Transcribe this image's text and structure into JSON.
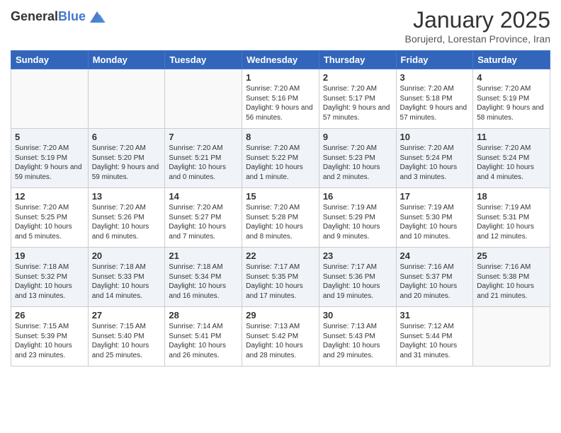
{
  "header": {
    "logo_general": "General",
    "logo_blue": "Blue",
    "month_title": "January 2025",
    "location": "Borujerd, Lorestan Province, Iran"
  },
  "days_of_week": [
    "Sunday",
    "Monday",
    "Tuesday",
    "Wednesday",
    "Thursday",
    "Friday",
    "Saturday"
  ],
  "weeks": [
    [
      {
        "day": "",
        "info": ""
      },
      {
        "day": "",
        "info": ""
      },
      {
        "day": "",
        "info": ""
      },
      {
        "day": "1",
        "info": "Sunrise: 7:20 AM\nSunset: 5:16 PM\nDaylight: 9 hours\nand 56 minutes."
      },
      {
        "day": "2",
        "info": "Sunrise: 7:20 AM\nSunset: 5:17 PM\nDaylight: 9 hours\nand 57 minutes."
      },
      {
        "day": "3",
        "info": "Sunrise: 7:20 AM\nSunset: 5:18 PM\nDaylight: 9 hours\nand 57 minutes."
      },
      {
        "day": "4",
        "info": "Sunrise: 7:20 AM\nSunset: 5:19 PM\nDaylight: 9 hours\nand 58 minutes."
      }
    ],
    [
      {
        "day": "5",
        "info": "Sunrise: 7:20 AM\nSunset: 5:19 PM\nDaylight: 9 hours\nand 59 minutes."
      },
      {
        "day": "6",
        "info": "Sunrise: 7:20 AM\nSunset: 5:20 PM\nDaylight: 9 hours\nand 59 minutes."
      },
      {
        "day": "7",
        "info": "Sunrise: 7:20 AM\nSunset: 5:21 PM\nDaylight: 10 hours\nand 0 minutes."
      },
      {
        "day": "8",
        "info": "Sunrise: 7:20 AM\nSunset: 5:22 PM\nDaylight: 10 hours\nand 1 minute."
      },
      {
        "day": "9",
        "info": "Sunrise: 7:20 AM\nSunset: 5:23 PM\nDaylight: 10 hours\nand 2 minutes."
      },
      {
        "day": "10",
        "info": "Sunrise: 7:20 AM\nSunset: 5:24 PM\nDaylight: 10 hours\nand 3 minutes."
      },
      {
        "day": "11",
        "info": "Sunrise: 7:20 AM\nSunset: 5:24 PM\nDaylight: 10 hours\nand 4 minutes."
      }
    ],
    [
      {
        "day": "12",
        "info": "Sunrise: 7:20 AM\nSunset: 5:25 PM\nDaylight: 10 hours\nand 5 minutes."
      },
      {
        "day": "13",
        "info": "Sunrise: 7:20 AM\nSunset: 5:26 PM\nDaylight: 10 hours\nand 6 minutes."
      },
      {
        "day": "14",
        "info": "Sunrise: 7:20 AM\nSunset: 5:27 PM\nDaylight: 10 hours\nand 7 minutes."
      },
      {
        "day": "15",
        "info": "Sunrise: 7:20 AM\nSunset: 5:28 PM\nDaylight: 10 hours\nand 8 minutes."
      },
      {
        "day": "16",
        "info": "Sunrise: 7:19 AM\nSunset: 5:29 PM\nDaylight: 10 hours\nand 9 minutes."
      },
      {
        "day": "17",
        "info": "Sunrise: 7:19 AM\nSunset: 5:30 PM\nDaylight: 10 hours\nand 10 minutes."
      },
      {
        "day": "18",
        "info": "Sunrise: 7:19 AM\nSunset: 5:31 PM\nDaylight: 10 hours\nand 12 minutes."
      }
    ],
    [
      {
        "day": "19",
        "info": "Sunrise: 7:18 AM\nSunset: 5:32 PM\nDaylight: 10 hours\nand 13 minutes."
      },
      {
        "day": "20",
        "info": "Sunrise: 7:18 AM\nSunset: 5:33 PM\nDaylight: 10 hours\nand 14 minutes."
      },
      {
        "day": "21",
        "info": "Sunrise: 7:18 AM\nSunset: 5:34 PM\nDaylight: 10 hours\nand 16 minutes."
      },
      {
        "day": "22",
        "info": "Sunrise: 7:17 AM\nSunset: 5:35 PM\nDaylight: 10 hours\nand 17 minutes."
      },
      {
        "day": "23",
        "info": "Sunrise: 7:17 AM\nSunset: 5:36 PM\nDaylight: 10 hours\nand 19 minutes."
      },
      {
        "day": "24",
        "info": "Sunrise: 7:16 AM\nSunset: 5:37 PM\nDaylight: 10 hours\nand 20 minutes."
      },
      {
        "day": "25",
        "info": "Sunrise: 7:16 AM\nSunset: 5:38 PM\nDaylight: 10 hours\nand 21 minutes."
      }
    ],
    [
      {
        "day": "26",
        "info": "Sunrise: 7:15 AM\nSunset: 5:39 PM\nDaylight: 10 hours\nand 23 minutes."
      },
      {
        "day": "27",
        "info": "Sunrise: 7:15 AM\nSunset: 5:40 PM\nDaylight: 10 hours\nand 25 minutes."
      },
      {
        "day": "28",
        "info": "Sunrise: 7:14 AM\nSunset: 5:41 PM\nDaylight: 10 hours\nand 26 minutes."
      },
      {
        "day": "29",
        "info": "Sunrise: 7:13 AM\nSunset: 5:42 PM\nDaylight: 10 hours\nand 28 minutes."
      },
      {
        "day": "30",
        "info": "Sunrise: 7:13 AM\nSunset: 5:43 PM\nDaylight: 10 hours\nand 29 minutes."
      },
      {
        "day": "31",
        "info": "Sunrise: 7:12 AM\nSunset: 5:44 PM\nDaylight: 10 hours\nand 31 minutes."
      },
      {
        "day": "",
        "info": ""
      }
    ]
  ]
}
